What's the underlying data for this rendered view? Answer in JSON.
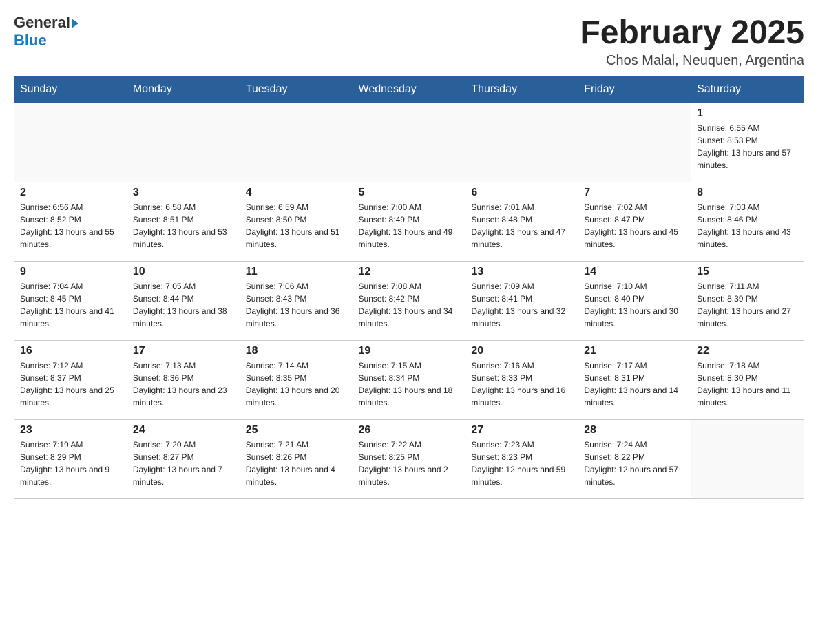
{
  "header": {
    "logo_general": "General",
    "logo_blue": "Blue",
    "month_title": "February 2025",
    "location": "Chos Malal, Neuquen, Argentina"
  },
  "days_of_week": [
    "Sunday",
    "Monday",
    "Tuesday",
    "Wednesday",
    "Thursday",
    "Friday",
    "Saturday"
  ],
  "weeks": [
    [
      {
        "day": "",
        "info": ""
      },
      {
        "day": "",
        "info": ""
      },
      {
        "day": "",
        "info": ""
      },
      {
        "day": "",
        "info": ""
      },
      {
        "day": "",
        "info": ""
      },
      {
        "day": "",
        "info": ""
      },
      {
        "day": "1",
        "info": "Sunrise: 6:55 AM\nSunset: 8:53 PM\nDaylight: 13 hours and 57 minutes."
      }
    ],
    [
      {
        "day": "2",
        "info": "Sunrise: 6:56 AM\nSunset: 8:52 PM\nDaylight: 13 hours and 55 minutes."
      },
      {
        "day": "3",
        "info": "Sunrise: 6:58 AM\nSunset: 8:51 PM\nDaylight: 13 hours and 53 minutes."
      },
      {
        "day": "4",
        "info": "Sunrise: 6:59 AM\nSunset: 8:50 PM\nDaylight: 13 hours and 51 minutes."
      },
      {
        "day": "5",
        "info": "Sunrise: 7:00 AM\nSunset: 8:49 PM\nDaylight: 13 hours and 49 minutes."
      },
      {
        "day": "6",
        "info": "Sunrise: 7:01 AM\nSunset: 8:48 PM\nDaylight: 13 hours and 47 minutes."
      },
      {
        "day": "7",
        "info": "Sunrise: 7:02 AM\nSunset: 8:47 PM\nDaylight: 13 hours and 45 minutes."
      },
      {
        "day": "8",
        "info": "Sunrise: 7:03 AM\nSunset: 8:46 PM\nDaylight: 13 hours and 43 minutes."
      }
    ],
    [
      {
        "day": "9",
        "info": "Sunrise: 7:04 AM\nSunset: 8:45 PM\nDaylight: 13 hours and 41 minutes."
      },
      {
        "day": "10",
        "info": "Sunrise: 7:05 AM\nSunset: 8:44 PM\nDaylight: 13 hours and 38 minutes."
      },
      {
        "day": "11",
        "info": "Sunrise: 7:06 AM\nSunset: 8:43 PM\nDaylight: 13 hours and 36 minutes."
      },
      {
        "day": "12",
        "info": "Sunrise: 7:08 AM\nSunset: 8:42 PM\nDaylight: 13 hours and 34 minutes."
      },
      {
        "day": "13",
        "info": "Sunrise: 7:09 AM\nSunset: 8:41 PM\nDaylight: 13 hours and 32 minutes."
      },
      {
        "day": "14",
        "info": "Sunrise: 7:10 AM\nSunset: 8:40 PM\nDaylight: 13 hours and 30 minutes."
      },
      {
        "day": "15",
        "info": "Sunrise: 7:11 AM\nSunset: 8:39 PM\nDaylight: 13 hours and 27 minutes."
      }
    ],
    [
      {
        "day": "16",
        "info": "Sunrise: 7:12 AM\nSunset: 8:37 PM\nDaylight: 13 hours and 25 minutes."
      },
      {
        "day": "17",
        "info": "Sunrise: 7:13 AM\nSunset: 8:36 PM\nDaylight: 13 hours and 23 minutes."
      },
      {
        "day": "18",
        "info": "Sunrise: 7:14 AM\nSunset: 8:35 PM\nDaylight: 13 hours and 20 minutes."
      },
      {
        "day": "19",
        "info": "Sunrise: 7:15 AM\nSunset: 8:34 PM\nDaylight: 13 hours and 18 minutes."
      },
      {
        "day": "20",
        "info": "Sunrise: 7:16 AM\nSunset: 8:33 PM\nDaylight: 13 hours and 16 minutes."
      },
      {
        "day": "21",
        "info": "Sunrise: 7:17 AM\nSunset: 8:31 PM\nDaylight: 13 hours and 14 minutes."
      },
      {
        "day": "22",
        "info": "Sunrise: 7:18 AM\nSunset: 8:30 PM\nDaylight: 13 hours and 11 minutes."
      }
    ],
    [
      {
        "day": "23",
        "info": "Sunrise: 7:19 AM\nSunset: 8:29 PM\nDaylight: 13 hours and 9 minutes."
      },
      {
        "day": "24",
        "info": "Sunrise: 7:20 AM\nSunset: 8:27 PM\nDaylight: 13 hours and 7 minutes."
      },
      {
        "day": "25",
        "info": "Sunrise: 7:21 AM\nSunset: 8:26 PM\nDaylight: 13 hours and 4 minutes."
      },
      {
        "day": "26",
        "info": "Sunrise: 7:22 AM\nSunset: 8:25 PM\nDaylight: 13 hours and 2 minutes."
      },
      {
        "day": "27",
        "info": "Sunrise: 7:23 AM\nSunset: 8:23 PM\nDaylight: 12 hours and 59 minutes."
      },
      {
        "day": "28",
        "info": "Sunrise: 7:24 AM\nSunset: 8:22 PM\nDaylight: 12 hours and 57 minutes."
      },
      {
        "day": "",
        "info": ""
      }
    ]
  ]
}
